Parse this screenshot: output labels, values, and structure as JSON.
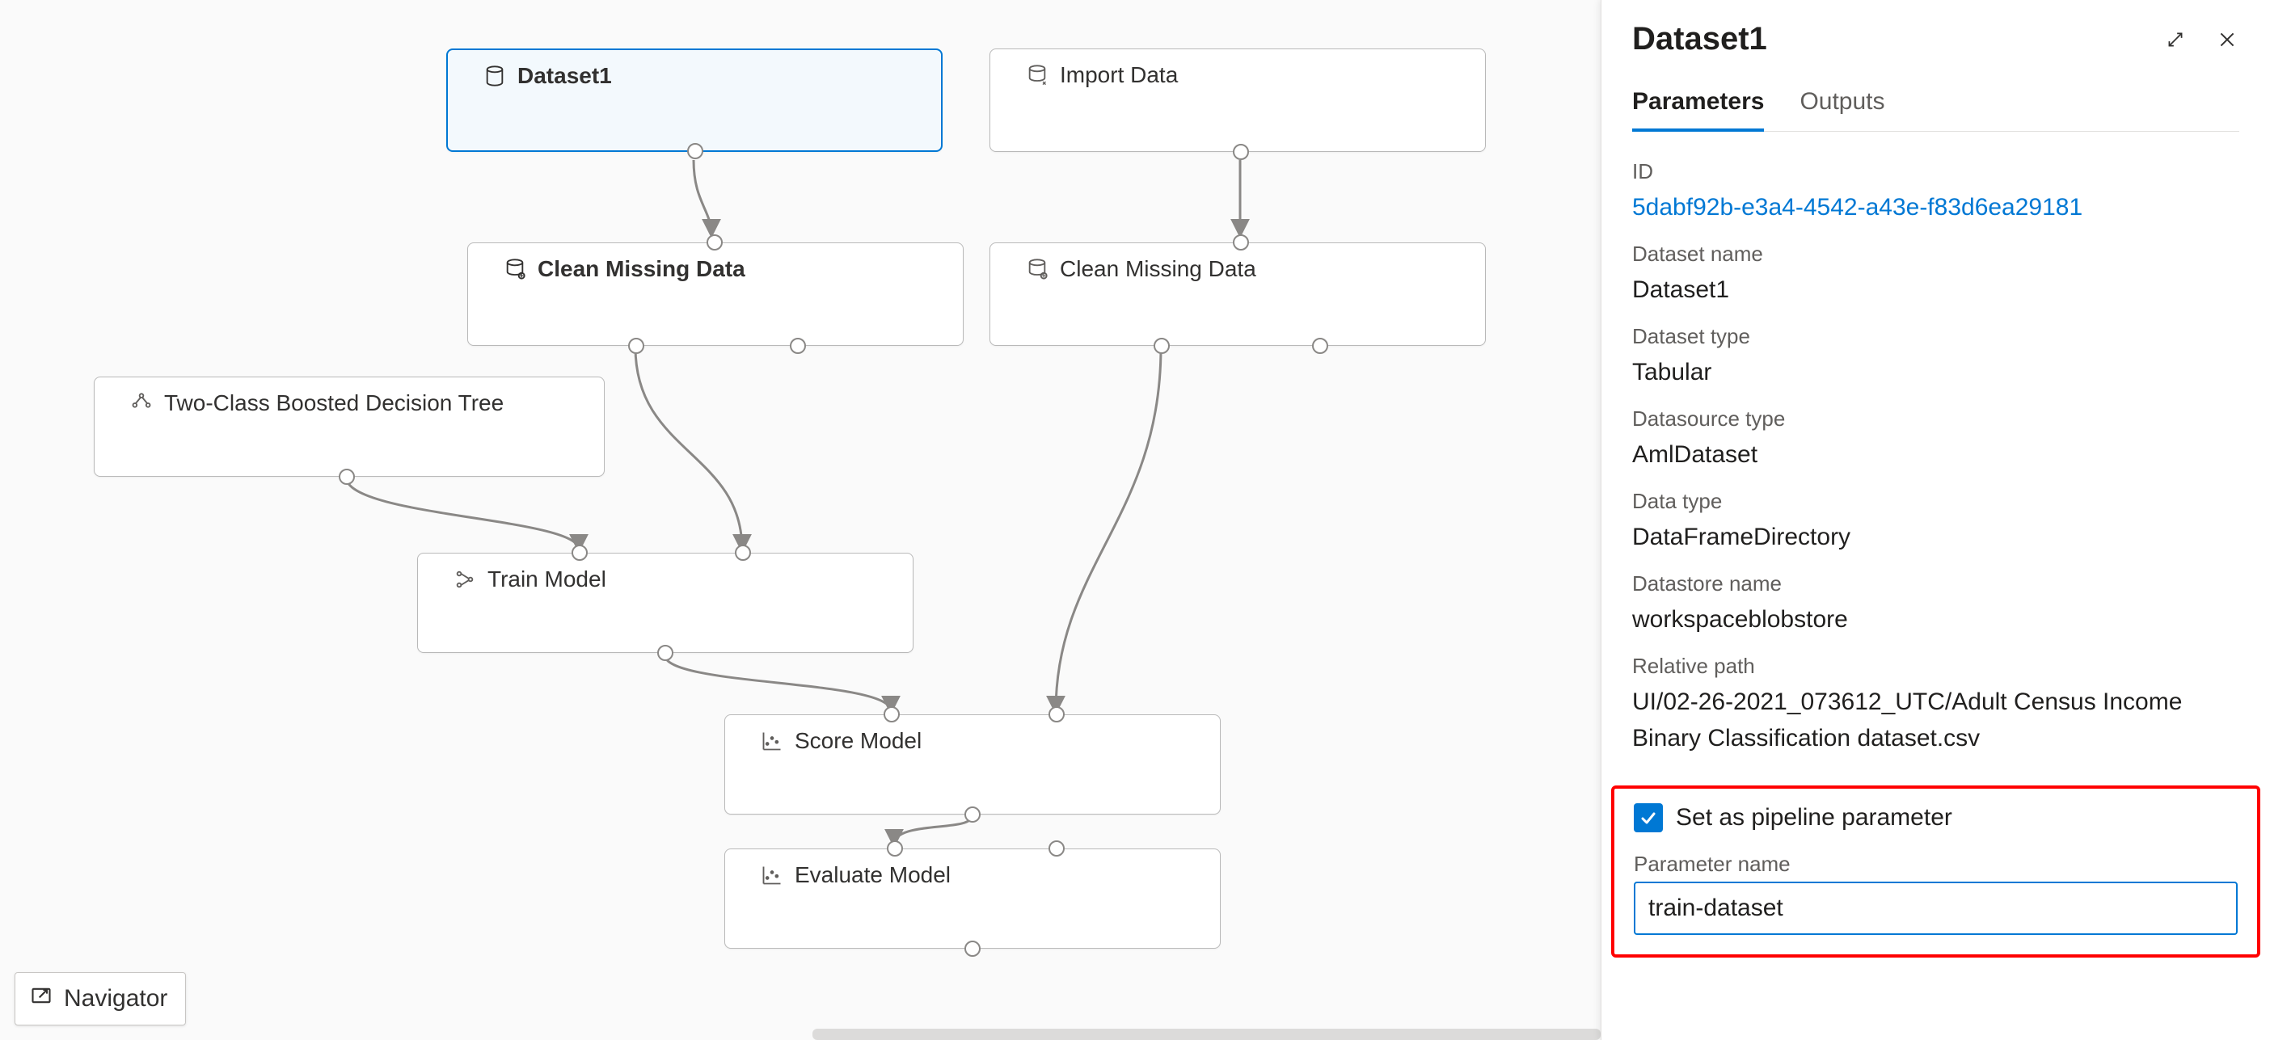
{
  "canvas": {
    "nodes": {
      "dataset1": {
        "label": "Dataset1"
      },
      "import_data": {
        "label": "Import Data"
      },
      "clean1": {
        "label": "Clean Missing Data"
      },
      "clean2": {
        "label": "Clean Missing Data"
      },
      "tree": {
        "label": "Two-Class Boosted Decision Tree"
      },
      "train": {
        "label": "Train Model"
      },
      "score": {
        "label": "Score Model"
      },
      "evaluate": {
        "label": "Evaluate Model"
      }
    }
  },
  "navigator_label": "Navigator",
  "panel": {
    "title": "Dataset1",
    "tabs": {
      "parameters": "Parameters",
      "outputs": "Outputs"
    },
    "id_label": "ID",
    "id_value": "5dabf92b-e3a4-4542-a43e-f83d6ea29181",
    "dataset_name_label": "Dataset name",
    "dataset_name_value": "Dataset1",
    "dataset_type_label": "Dataset type",
    "dataset_type_value": "Tabular",
    "datasource_type_label": "Datasource type",
    "datasource_type_value": "AmlDataset",
    "data_type_label": "Data type",
    "data_type_value": "DataFrameDirectory",
    "datastore_name_label": "Datastore name",
    "datastore_name_value": "workspaceblobstore",
    "relative_path_label": "Relative path",
    "relative_path_value": "UI/02-26-2021_073612_UTC/Adult Census Income Binary Classification dataset.csv",
    "set_as_pipeline_label": "Set as pipeline parameter",
    "parameter_name_label": "Parameter name",
    "parameter_name_value": "train-dataset"
  }
}
